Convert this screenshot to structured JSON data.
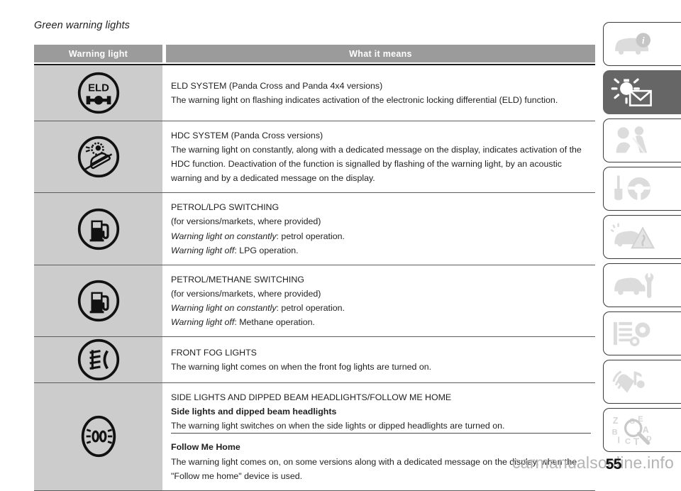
{
  "page": {
    "heading": "Green warning lights",
    "number": "55",
    "watermark": "carmanualsonline.info"
  },
  "table": {
    "columns": [
      {
        "key": "warning_light",
        "label": "Warning light"
      },
      {
        "key": "what_it_means",
        "label": "What it means"
      }
    ],
    "rows": [
      {
        "icon_name": "eld-system-icon",
        "icon_label": "ELD",
        "lines": [
          {
            "text": "ELD SYSTEM (Panda Cross and Panda 4x4 versions)",
            "style": "normal"
          },
          {
            "text": "The warning light on flashing indicates activation of the electronic locking differential (ELD) function.",
            "style": "normal"
          }
        ]
      },
      {
        "icon_name": "hdc-system-icon",
        "icon_label": "",
        "lines": [
          {
            "text": "HDC SYSTEM (Panda Cross versions)",
            "style": "normal"
          },
          {
            "text": "The warning light on constantly, along with a dedicated message on the display, indicates activation of the HDC function. Deactivation of the function is signalled by flashing of the warning light, by an acoustic warning and by a dedicated message on the display.",
            "style": "normal"
          }
        ]
      },
      {
        "icon_name": "fuel-pump-icon",
        "icon_label": "",
        "lines": [
          {
            "text": "PETROL/LPG SWITCHING",
            "style": "normal"
          },
          {
            "text": "(for versions/markets, where provided)",
            "style": "normal"
          },
          {
            "text": "Warning light on constantly",
            "suffix": ": petrol operation.",
            "style": "italic-lead"
          },
          {
            "text": "Warning light off",
            "suffix": ": LPG operation.",
            "style": "italic-lead"
          }
        ]
      },
      {
        "icon_name": "fuel-pump-icon",
        "icon_label": "",
        "lines": [
          {
            "text": "PETROL/METHANE SWITCHING",
            "style": "normal"
          },
          {
            "text": "(for versions/markets, where provided)",
            "style": "normal"
          },
          {
            "text": "Warning light on constantly",
            "suffix": ": petrol operation.",
            "style": "italic-lead"
          },
          {
            "text": "Warning light off",
            "suffix": ": Methane operation.",
            "style": "italic-lead"
          }
        ]
      },
      {
        "icon_name": "front-fog-lights-icon",
        "icon_label": "",
        "lines": [
          {
            "text": "FRONT FOG LIGHTS",
            "style": "normal"
          },
          {
            "text": "The warning light comes on when the front fog lights are turned on.",
            "style": "normal"
          }
        ]
      },
      {
        "icon_name": "side-lights-dipped-beam-icon",
        "icon_label": "",
        "lines": [
          {
            "text": "SIDE LIGHTS AND DIPPED BEAM HEADLIGHTS/FOLLOW ME HOME",
            "style": "normal"
          },
          {
            "text": "Side lights and dipped beam headlights",
            "style": "bold"
          },
          {
            "text": "The warning light switches on when the side lights or dipped headlights are turned on.",
            "style": "normal"
          }
        ],
        "lines2": [
          {
            "text": "Follow Me Home",
            "style": "bold"
          },
          {
            "text": "The warning light comes on, on some versions along with a dedicated message on the display, when the \"Follow me home\" device is used.",
            "style": "normal"
          }
        ]
      }
    ]
  },
  "tab_rail": {
    "tabs": [
      {
        "icon_name": "car-info-icon",
        "active": false
      },
      {
        "icon_name": "warning-lights-messages-icon",
        "active": true
      },
      {
        "icon_name": "occupant-safety-icon",
        "active": false
      },
      {
        "icon_name": "starting-driving-icon",
        "active": false
      },
      {
        "icon_name": "emergency-icon",
        "active": false
      },
      {
        "icon_name": "car-maintenance-icon",
        "active": false
      },
      {
        "icon_name": "technical-specifications-icon",
        "active": false
      },
      {
        "icon_name": "multimedia-icon",
        "active": false
      },
      {
        "icon_name": "alphabetical-index-icon",
        "active": false
      }
    ]
  },
  "colors": {
    "header_bar": "#9b9b9b",
    "icon_cell_bg": "#cccccc",
    "active_tab": "#666666",
    "rule": "#5d5d5d",
    "watermark": "#b4b4b4"
  }
}
